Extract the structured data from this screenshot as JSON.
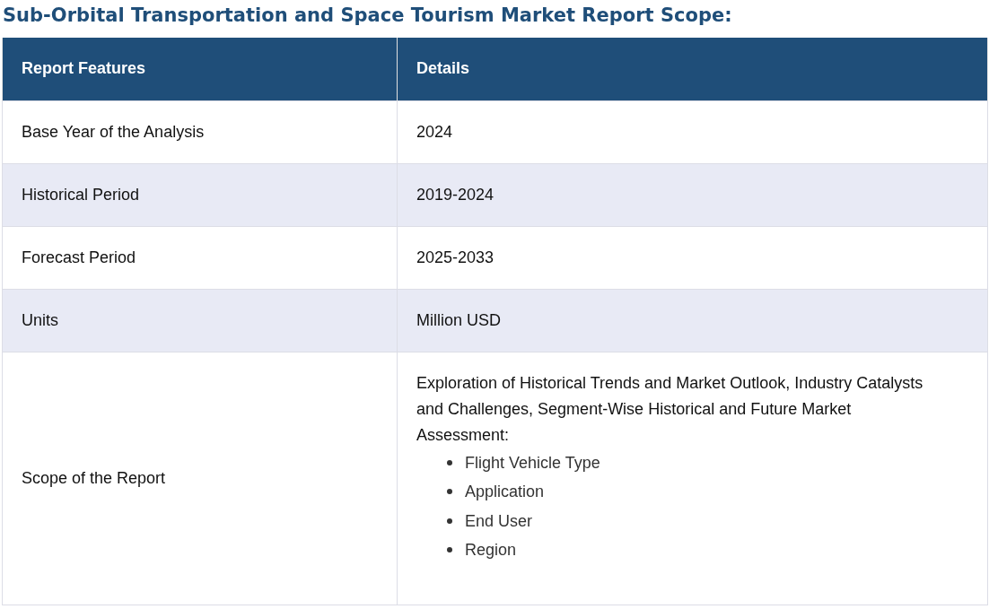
{
  "title": "Sub-Orbital Transportation and Space Tourism Market Report Scope:",
  "table": {
    "columns": [
      "Report Features",
      "Details"
    ],
    "rows": [
      {
        "kind": "text",
        "feature": "Base Year of the Analysis",
        "details": "2024"
      },
      {
        "kind": "text",
        "feature": "Historical Period",
        "details": "2019-2024"
      },
      {
        "kind": "text",
        "feature": "Forecast Period",
        "details": "2025-2033"
      },
      {
        "kind": "text",
        "feature": "Units",
        "details": "Million USD"
      },
      {
        "kind": "list",
        "feature": "Scope of the Report",
        "details": "Exploration of Historical Trends and Market Outlook, Industry Catalysts and Challenges, Segment-Wise Historical and Future Market Assessment:",
        "items": [
          "Flight Vehicle Type",
          "Application",
          "End User",
          "Region"
        ]
      }
    ]
  }
}
